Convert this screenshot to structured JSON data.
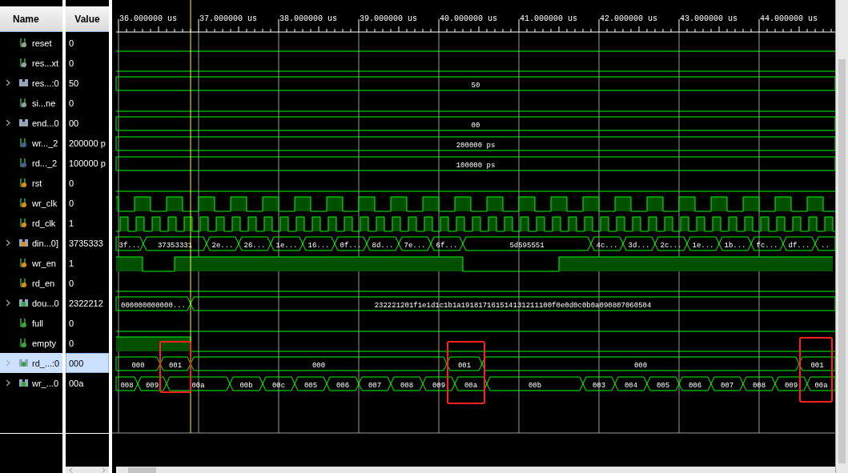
{
  "columns": {
    "name": "Name",
    "value": "Value"
  },
  "timeline": {
    "labels": [
      "36.000000 us",
      "37.000000 us",
      "38.000000 us",
      "39.000000 us",
      "40.000000 us",
      "41.000000 us",
      "42.000000 us",
      "43.000000 us",
      "44.000000 us"
    ]
  },
  "signals": [
    {
      "name": "reset",
      "value": "0",
      "kind": "bit",
      "color": "#9aa0a6",
      "selected": false
    },
    {
      "name": "res...xt",
      "value": "0",
      "kind": "bit",
      "color": "#9aa0a6",
      "selected": false
    },
    {
      "name": "res...:0",
      "value": "50",
      "kind": "bus",
      "color": "#9aa0a6",
      "selected": false,
      "expanded": false,
      "segments": [
        "50"
      ]
    },
    {
      "name": "si...ne",
      "value": "0",
      "kind": "bit",
      "color": "#9aa0a6",
      "selected": false
    },
    {
      "name": "end...0",
      "value": "00",
      "kind": "bus",
      "color": "#9aa0a6",
      "selected": false,
      "expanded": false,
      "segments": [
        "00"
      ]
    },
    {
      "name": "wr..._2",
      "value": "200000 p",
      "kind": "bus",
      "color": "#4a5aa8",
      "selected": false,
      "segments": [
        "200000 ps"
      ]
    },
    {
      "name": "rd..._2",
      "value": "100000 p",
      "kind": "bus",
      "color": "#4a5aa8",
      "selected": false,
      "segments": [
        "100000 ps"
      ]
    },
    {
      "name": "rst",
      "value": "0",
      "kind": "bit",
      "color": "#e8890c",
      "selected": false
    },
    {
      "name": "wr_clk",
      "value": "0",
      "kind": "clock",
      "color": "#e8890c",
      "selected": false
    },
    {
      "name": "rd_clk",
      "value": "1",
      "kind": "clock",
      "color": "#e8890c",
      "selected": false
    },
    {
      "name": "din...0]",
      "value": "3735333",
      "kind": "bus",
      "color": "#e8890c",
      "selected": false,
      "expanded": false,
      "segments": [
        "3f...",
        "37353331",
        "2e...",
        "26...",
        "1e...",
        "16...",
        "0f...",
        "8d...",
        "7e...",
        "6f...",
        "5d595551",
        "4c...",
        "3d...",
        "2c...",
        "1e...",
        "1b...",
        "fc...",
        "df...",
        ".."
      ]
    },
    {
      "name": "wr_en",
      "value": "1",
      "kind": "bit",
      "color": "#e8890c",
      "selected": false
    },
    {
      "name": "rd_en",
      "value": "0",
      "kind": "bit",
      "color": "#e8890c",
      "selected": false
    },
    {
      "name": "dou...0",
      "value": "2322212",
      "kind": "bus",
      "color": "#3aa43a",
      "selected": false,
      "expanded": false,
      "segments": [
        "000000000000...",
        "232221201f1e1d1c1b1a191817161514131211100f0e0d0c0b0a090807060504"
      ]
    },
    {
      "name": "full",
      "value": "0",
      "kind": "bit",
      "color": "#3aa43a",
      "selected": false
    },
    {
      "name": "empty",
      "value": "0",
      "kind": "bit",
      "color": "#3aa43a",
      "selected": false
    },
    {
      "name": "rd_...:0",
      "value": "000",
      "kind": "bus",
      "color": "#3aa43a",
      "selected": true,
      "expanded": false,
      "segments": [
        "000",
        "001",
        "000",
        "001",
        "000",
        "001"
      ]
    },
    {
      "name": "wr_...0",
      "value": "00a",
      "kind": "bus",
      "color": "#3aa43a",
      "selected": false,
      "expanded": false,
      "segments": [
        "008",
        "009",
        "00a",
        "00b",
        "00c",
        "005",
        "006",
        "007",
        "008",
        "009",
        "00a",
        "00b",
        "003",
        "004",
        "005",
        "006",
        "007",
        "008",
        "009",
        "00a"
      ]
    }
  ]
}
